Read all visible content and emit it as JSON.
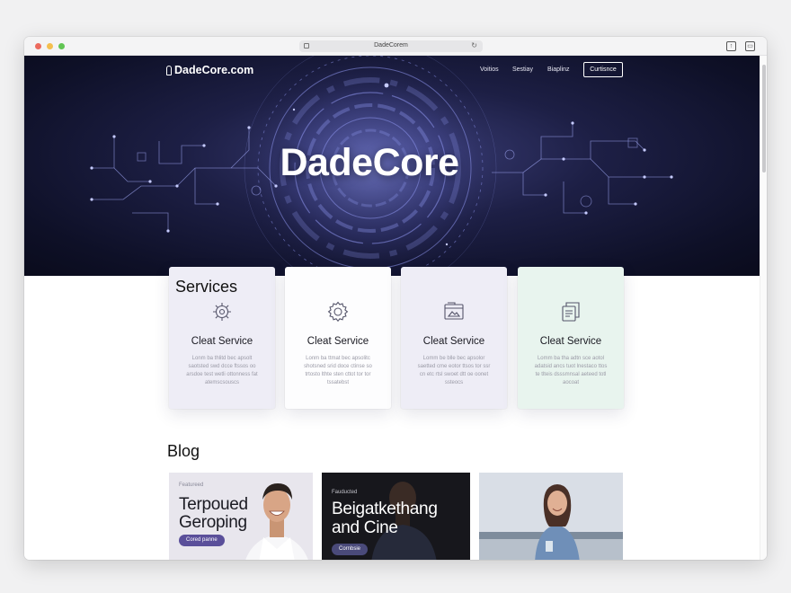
{
  "browser": {
    "address": "DadeCorem"
  },
  "site": {
    "logo": "DadeCore.com",
    "nav": [
      {
        "label": "Voitios"
      },
      {
        "label": "Sestiay"
      },
      {
        "label": "Biaplinz"
      }
    ],
    "nav_cta": "Curtisnce",
    "hero_title": "DadeCore"
  },
  "services": {
    "title": "Services",
    "cards": [
      {
        "title": "Cleat Service",
        "icon": "gear-icon",
        "bg": "#eeedf6",
        "desc": "Lonm ba thlitd bec apsolt saotsted swd dcce ftssos oo arsdoe test wetli ottonness fat atemscsouscs"
      },
      {
        "title": "Cleat Service",
        "icon": "gear-icon",
        "bg": "#fdfdfe",
        "desc": "Lonm ba ttmat bec apsolitc shotsned srid doce ctinse so trtosto lthte sten cttot tor tor tssatebst"
      },
      {
        "title": "Cleat Service",
        "icon": "browser-window-icon",
        "bg": "#eeedf6",
        "desc": "Lomm be blle bec apsolor saetted cme eotor ttsos tor ssr cn etc rtsl swoet dtt oe oonet ssteocs"
      },
      {
        "title": "Cleat Service",
        "icon": "documents-icon",
        "bg": "#e8f4ee",
        "desc": "Lomm ba tha adtn sce aotol adatsid ancs tuot lnestaco ttos te tlteis dsssmnsal aeteed totl aocoat"
      }
    ]
  },
  "blog": {
    "title": "Blog",
    "posts": [
      {
        "tag": "Featureed",
        "headline_1": "Terpoued",
        "headline_2": "Geroping",
        "button": "Cored panne"
      },
      {
        "tag": "Fauducted",
        "headline_1": "Beigatkethang",
        "headline_2": "and Cine",
        "button": "Cornbsie"
      },
      {
        "tag": "",
        "headline_1": "",
        "headline_2": "",
        "button": ""
      }
    ]
  },
  "colors": {
    "accent": "#5a4f9a",
    "hero_dark": "#0e1027",
    "hero_glow": "#8f98f0"
  }
}
